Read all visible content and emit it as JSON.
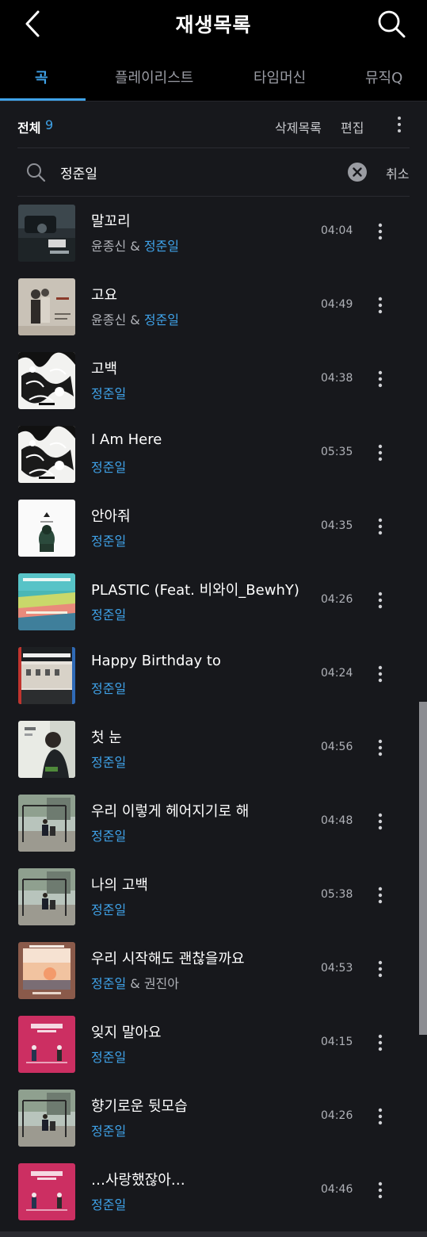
{
  "header": {
    "title": "재생목록",
    "back_icon": "chevron-left-icon",
    "search_icon": "search-icon"
  },
  "tabs": [
    {
      "label": "곡",
      "active": true
    },
    {
      "label": "플레이리스트",
      "active": false
    },
    {
      "label": "타임머신",
      "active": false
    },
    {
      "label": "뮤직Q",
      "active": false
    }
  ],
  "summary": {
    "total_label": "전체",
    "total_count": "9",
    "deleted_list_label": "삭제목록",
    "edit_label": "편집",
    "more_icon": "more-vertical-icon"
  },
  "search": {
    "value": "정준일",
    "clear_icon": "clear-circle-icon",
    "cancel_label": "취소"
  },
  "songs": [
    {
      "title": "말꼬리",
      "artist_plain": "윤종신 & ",
      "artist_highlight": "정준일",
      "artist_trailing": "",
      "duration": "04:04",
      "art": "dark-car"
    },
    {
      "title": "고요",
      "artist_plain": "윤종신 & ",
      "artist_highlight": "정준일",
      "artist_trailing": "",
      "duration": "04:49",
      "art": "portrait-beige"
    },
    {
      "title": "고백",
      "artist_plain": "",
      "artist_highlight": "정준일",
      "artist_trailing": "",
      "duration": "04:38",
      "art": "bw-illustration"
    },
    {
      "title": "I Am Here",
      "artist_plain": "",
      "artist_highlight": "정준일",
      "artist_trailing": "",
      "duration": "05:35",
      "art": "bw-illustration"
    },
    {
      "title": "안아줘",
      "artist_plain": "",
      "artist_highlight": "정준일",
      "artist_trailing": "",
      "duration": "04:35",
      "art": "white-figure"
    },
    {
      "title": "PLASTIC (Feat. 비와이_BewhY)",
      "artist_plain": "",
      "artist_highlight": "정준일",
      "artist_trailing": "",
      "duration": "04:26",
      "art": "underwater"
    },
    {
      "title": "Happy Birthday to",
      "artist_plain": "",
      "artist_highlight": "정준일",
      "artist_trailing": "",
      "duration": "04:24",
      "art": "red-building"
    },
    {
      "title": "첫 눈",
      "artist_plain": "",
      "artist_highlight": "정준일",
      "artist_trailing": "",
      "duration": "04:56",
      "art": "goblin-ost"
    },
    {
      "title": "우리 이렇게 헤어지기로 해",
      "artist_plain": "",
      "artist_highlight": "정준일",
      "artist_trailing": "",
      "duration": "04:48",
      "art": "swing"
    },
    {
      "title": "나의 고백",
      "artist_plain": "",
      "artist_highlight": "정준일",
      "artist_trailing": "",
      "duration": "05:38",
      "art": "swing"
    },
    {
      "title": "우리 시작해도 괜찮을까요",
      "artist_plain": "",
      "artist_highlight": "정준일",
      "artist_trailing": " & 권진아",
      "duration": "04:53",
      "art": "sunset"
    },
    {
      "title": "잊지 말아요",
      "artist_plain": "",
      "artist_highlight": "정준일",
      "artist_trailing": "",
      "duration": "04:15",
      "art": "pink-ost"
    },
    {
      "title": "향기로운 뒷모습",
      "artist_plain": "",
      "artist_highlight": "정준일",
      "artist_trailing": "",
      "duration": "04:26",
      "art": "swing"
    },
    {
      "title": "…사랑했잖아…",
      "artist_plain": "",
      "artist_highlight": "정준일",
      "artist_trailing": "",
      "duration": "04:46",
      "art": "pink-ost"
    }
  ],
  "colors": {
    "accent": "#3fa2e8",
    "background": "#17181c",
    "header_background": "#000000"
  }
}
